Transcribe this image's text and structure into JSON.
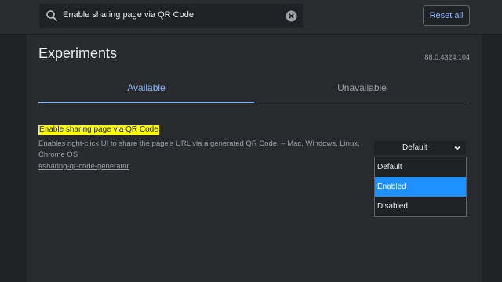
{
  "search": {
    "value": "Enable sharing page via QR Code"
  },
  "header": {
    "reset_label": "Reset all"
  },
  "page": {
    "title": "Experiments",
    "version": "88.0.4324.104"
  },
  "tabs": [
    {
      "label": "Available",
      "selected": true
    },
    {
      "label": "Unavailable",
      "selected": false
    }
  ],
  "experiment": {
    "name": "Enable sharing page via QR Code",
    "description": "Enables right-click UI to share the page's URL via a generated QR Code. – Mac, Windows, Linux, Chrome OS",
    "link": "#sharing-qr-code-generator",
    "select_value": "Default",
    "options": [
      "Default",
      "Enabled",
      "Disabled"
    ],
    "highlighted_option": "Enabled"
  },
  "colors": {
    "accent": "#8ab4f8",
    "highlight": "#ffff00",
    "option_selected": "#1e90ff",
    "background": "#202124",
    "panel": "#292a2d"
  }
}
